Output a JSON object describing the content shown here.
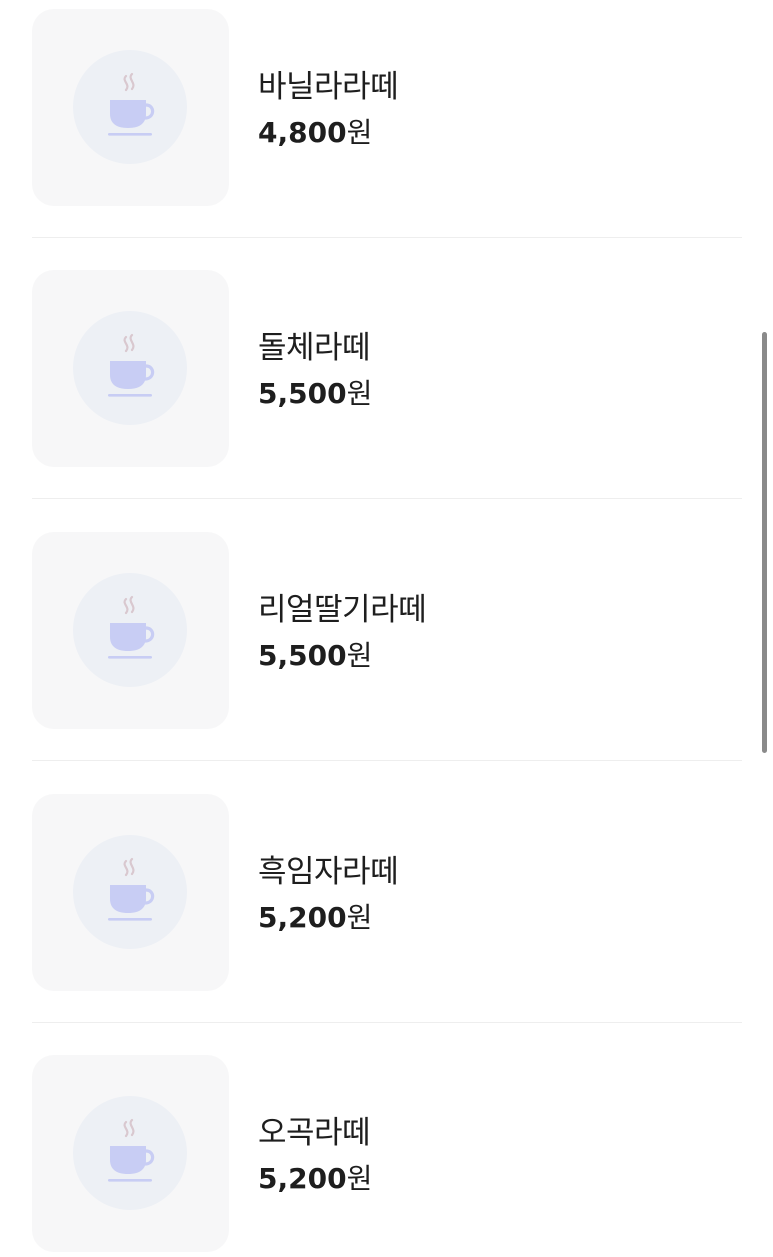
{
  "menu": {
    "items": [
      {
        "name": "바닐라라떼",
        "price": "4,800",
        "unit": "원",
        "icon": "coffee-cup-icon"
      },
      {
        "name": "돌체라떼",
        "price": "5,500",
        "unit": "원",
        "icon": "coffee-cup-icon"
      },
      {
        "name": "리얼딸기라떼",
        "price": "5,500",
        "unit": "원",
        "icon": "coffee-cup-icon"
      },
      {
        "name": "흑임자라떼",
        "price": "5,200",
        "unit": "원",
        "icon": "coffee-cup-icon"
      },
      {
        "name": "오곡라떼",
        "price": "5,200",
        "unit": "원",
        "icon": "coffee-cup-icon"
      }
    ]
  },
  "colors": {
    "thumb_bg": "#f7f7f8",
    "circle_bg": "#edf0f5",
    "cup": "#c8cdf4",
    "steam": "#d9c8cf"
  }
}
